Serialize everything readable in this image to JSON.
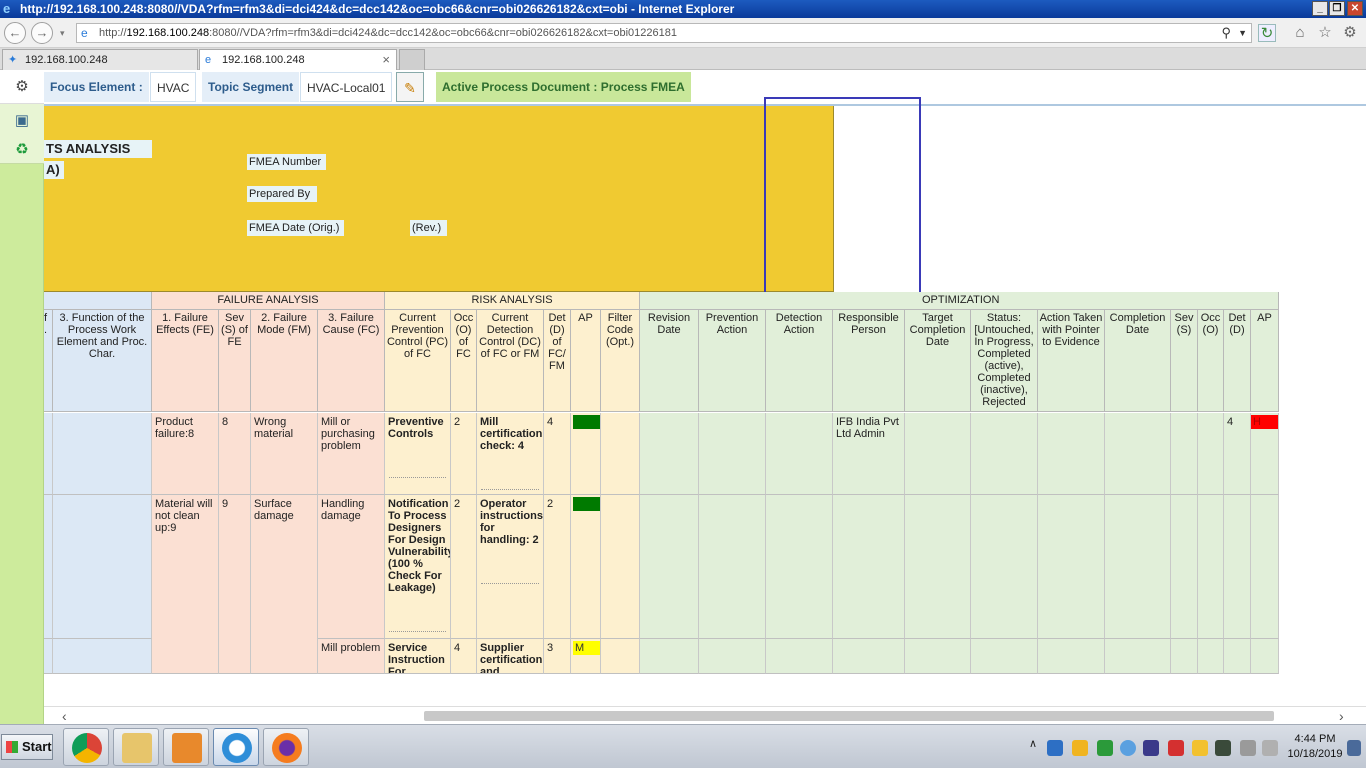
{
  "window": {
    "title": "http://192.168.100.248:8080//VDA?rfm=rfm3&di=dci424&dc=dcc142&oc=obc66&cnr=obi026626182&cxt=obi - Internet Explorer",
    "min_label": "_",
    "restore_label": "❐",
    "close_label": "✕"
  },
  "browser": {
    "url_prefix": "http://",
    "url_host": "192.168.100.248",
    "url_rest": ":8080//VDA?rfm=rfm3&di=dci424&dc=dcc142&oc=obc66&cnr=obi026626182&cxt=obi01226181",
    "tabs": [
      {
        "label": "192.168.100.248"
      },
      {
        "label": "192.168.100.248",
        "close": "×"
      }
    ]
  },
  "header": {
    "focus_label": "Focus Element :",
    "focus_value": "HVAC",
    "topic_label": "Topic Segment",
    "topic_value": "HVAC-Local01",
    "active_doc": "Active Process Document : Process FMEA"
  },
  "title_block": {
    "title_line1": "TS ANALYSIS",
    "title_line2": "A)",
    "fmea_number": "FMEA Number",
    "prepared_by": "Prepared By",
    "fmea_date": "FMEA Date (Orig.)",
    "rev": "(Rev.)"
  },
  "groups": {
    "failure": "FAILURE ANALYSIS",
    "risk": "RISK ANALYSIS",
    "optimization": "OPTIMIZATION"
  },
  "columns": {
    "partial": "f .",
    "function": "3. Function of the Process Work Element and Proc. Char.",
    "fe": "1. Failure Effects (FE)",
    "sev": "Sev (S) of FE",
    "fm": "2. Failure Mode (FM)",
    "fc": "3. Failure Cause (FC)",
    "pc": "Current Prevention Control (PC) of FC",
    "occ": "Occ (O) of FC",
    "dc": "Current Detection Control (DC) of FC or FM",
    "det": "Det (D) of FC/ FM",
    "ap": "AP",
    "filter": "Filter Code (Opt.)",
    "rev_date": "Revision Date",
    "prev_action": "Prevention Action",
    "det_action": "Detection Action",
    "resp": "Responsible Person",
    "target": "Target Completion Date",
    "status": "Status: [Untouched, In Progress, Completed (active), Completed (inactive), Rejected",
    "action_taken": "Action Taken with Pointer to Evidence",
    "completion": "Completion Date",
    "sev2": "Sev (S)",
    "occ2": "Occ (O)",
    "det2": "Det (D)",
    "ap2": "AP"
  },
  "rows": [
    {
      "fe": "Product failure:8",
      "sev": "8",
      "fm": "Wrong material",
      "fc": "Mill or purchasing problem",
      "pc": "Preventive Controls",
      "occ": "2",
      "dc": "Mill certification check: 4",
      "det": "4",
      "ap": "L",
      "resp": "IFB India Pvt Ltd Admin",
      "det2": "4",
      "ap2": "H"
    },
    {
      "fe": "Material will not clean up:9",
      "sev": "9",
      "fm": "Surface damage",
      "fc": "Handling damage",
      "pc": "Notification To Process Designers For Design Vulnerability (100 % Check For Leakage)",
      "occ": "2",
      "dc": "Operator instructions for handling: 2",
      "det": "2",
      "ap": "L"
    },
    {
      "fc": "Mill problem",
      "pc": "Service Instruction For",
      "occ": "4",
      "dc": "Supplier certification and",
      "det": "3",
      "ap": "M"
    }
  ],
  "colors": {
    "ap_low": "#007a00",
    "ap_medium": "#ffff00",
    "ap_high": "#ff0000",
    "yellow_block": "#f0ca31",
    "failure_bg": "#fbe0d3",
    "risk_bg": "#fdf0cf",
    "optimization_bg": "#e1efd9",
    "function_bg": "#dce8f5"
  },
  "taskbar": {
    "start": "Start",
    "time": "4:44 PM",
    "date": "10/18/2019"
  }
}
